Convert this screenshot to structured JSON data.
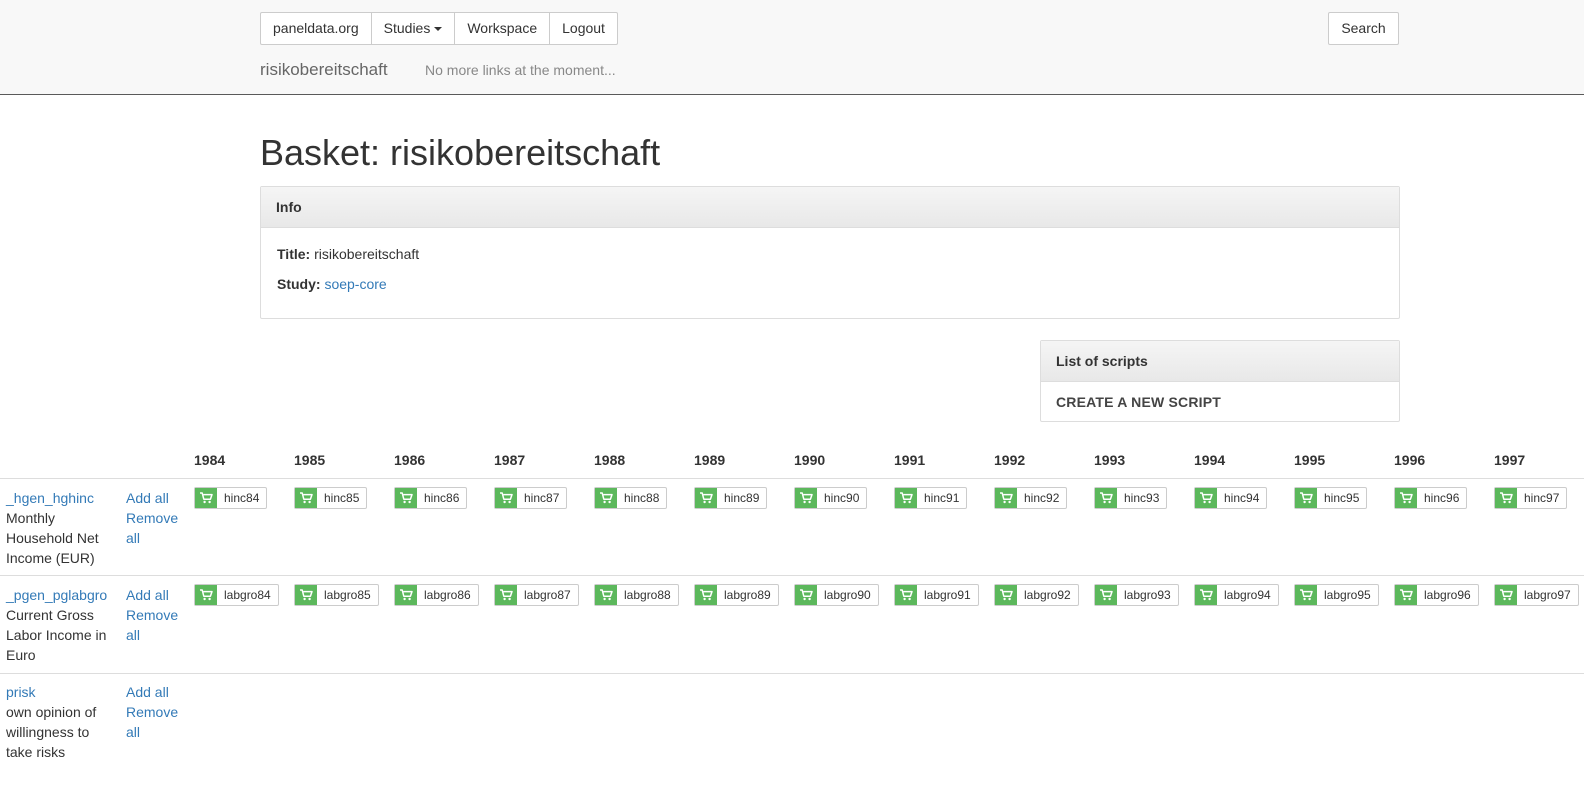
{
  "nav": {
    "site": "paneldata.org",
    "studies": "Studies",
    "workspace": "Workspace",
    "logout": "Logout",
    "search": "Search",
    "brand": "risikobereitschaft",
    "note": "No more links at the moment..."
  },
  "page": {
    "title": "Basket: risikobereitschaft"
  },
  "info": {
    "heading": "Info",
    "title_label": "Title:",
    "title_value": "risikobereitschaft",
    "study_label": "Study:",
    "study_value": "soep-core"
  },
  "scripts": {
    "heading": "List of scripts",
    "create": "CREATE A NEW SCRIPT"
  },
  "table": {
    "years": [
      "1984",
      "1985",
      "1986",
      "1987",
      "1988",
      "1989",
      "1990",
      "1991",
      "1992",
      "1993",
      "1994",
      "1995",
      "1996",
      "1997"
    ],
    "rows": [
      {
        "name": "_hgen_hghinc",
        "desc": "Monthly Household Net Income (EUR)",
        "add": "Add all",
        "remove": "Remove all",
        "vars": [
          "hinc84",
          "hinc85",
          "hinc86",
          "hinc87",
          "hinc88",
          "hinc89",
          "hinc90",
          "hinc91",
          "hinc92",
          "hinc93",
          "hinc94",
          "hinc95",
          "hinc96",
          "hinc97"
        ]
      },
      {
        "name": "_pgen_pglabgro",
        "desc": "Current Gross Labor Income in Euro",
        "add": "Add all",
        "remove": "Remove all",
        "vars": [
          "labgro84",
          "labgro85",
          "labgro86",
          "labgro87",
          "labgro88",
          "labgro89",
          "labgro90",
          "labgro91",
          "labgro92",
          "labgro93",
          "labgro94",
          "labgro95",
          "labgro96",
          "labgro97"
        ]
      },
      {
        "name": "prisk",
        "desc": "own opinion of willingness to take risks",
        "add": "Add all",
        "remove": "Remove all",
        "vars": []
      }
    ]
  }
}
